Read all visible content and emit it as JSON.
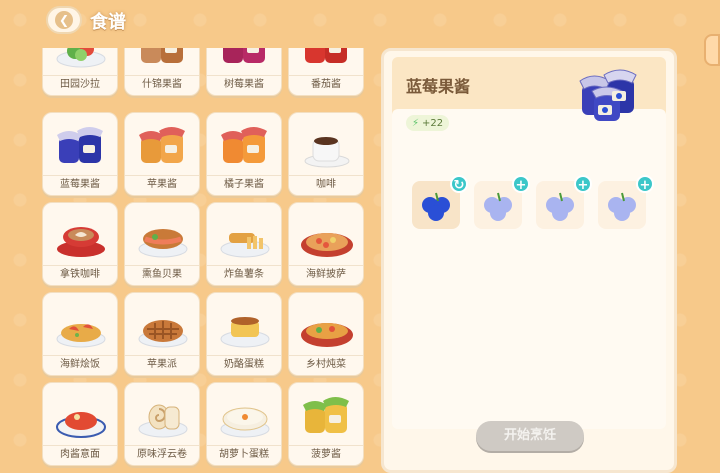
{
  "header": {
    "title": "食谱"
  },
  "recipes": [
    {
      "name": "田园沙拉",
      "icon": "salad-icon"
    },
    {
      "name": "什锦果酱",
      "icon": "mixed-jam-icon"
    },
    {
      "name": "树莓果酱",
      "icon": "raspberry-jam-icon"
    },
    {
      "name": "番茄酱",
      "icon": "ketchup-icon"
    },
    {
      "name": "蓝莓果酱",
      "icon": "blueberry-jam-icon"
    },
    {
      "name": "苹果酱",
      "icon": "apple-jam-icon"
    },
    {
      "name": "橘子果酱",
      "icon": "orange-jam-icon"
    },
    {
      "name": "咖啡",
      "icon": "coffee-icon"
    },
    {
      "name": "拿铁咖啡",
      "icon": "latte-icon"
    },
    {
      "name": "熏鱼贝果",
      "icon": "bagel-icon"
    },
    {
      "name": "炸鱼薯条",
      "icon": "fish-chips-icon"
    },
    {
      "name": "海鲜披萨",
      "icon": "seafood-pizza-icon"
    },
    {
      "name": "海鲜烩饭",
      "icon": "paella-icon"
    },
    {
      "name": "苹果派",
      "icon": "apple-pie-icon"
    },
    {
      "name": "奶酪蛋糕",
      "icon": "cheesecake-icon"
    },
    {
      "name": "乡村炖菜",
      "icon": "stew-icon"
    },
    {
      "name": "肉酱意面",
      "icon": "spaghetti-icon"
    },
    {
      "name": "原味浮云卷",
      "icon": "roll-cake-icon"
    },
    {
      "name": "胡萝卜蛋糕",
      "icon": "carrot-cake-icon"
    },
    {
      "name": "菠萝酱",
      "icon": "pineapple-jam-icon"
    }
  ],
  "detail": {
    "name": "蓝莓果酱",
    "energy": "+22",
    "slots": [
      {
        "state": "filled",
        "badge": "refresh"
      },
      {
        "state": "empty",
        "badge": "add"
      },
      {
        "state": "empty",
        "badge": "add"
      },
      {
        "state": "empty",
        "badge": "add"
      }
    ],
    "cook_label": "开始烹饪"
  },
  "colors": {
    "background": "#f7c98a",
    "accent_teal": "#3cc7c9",
    "blueberry": "#2a4fd6"
  }
}
